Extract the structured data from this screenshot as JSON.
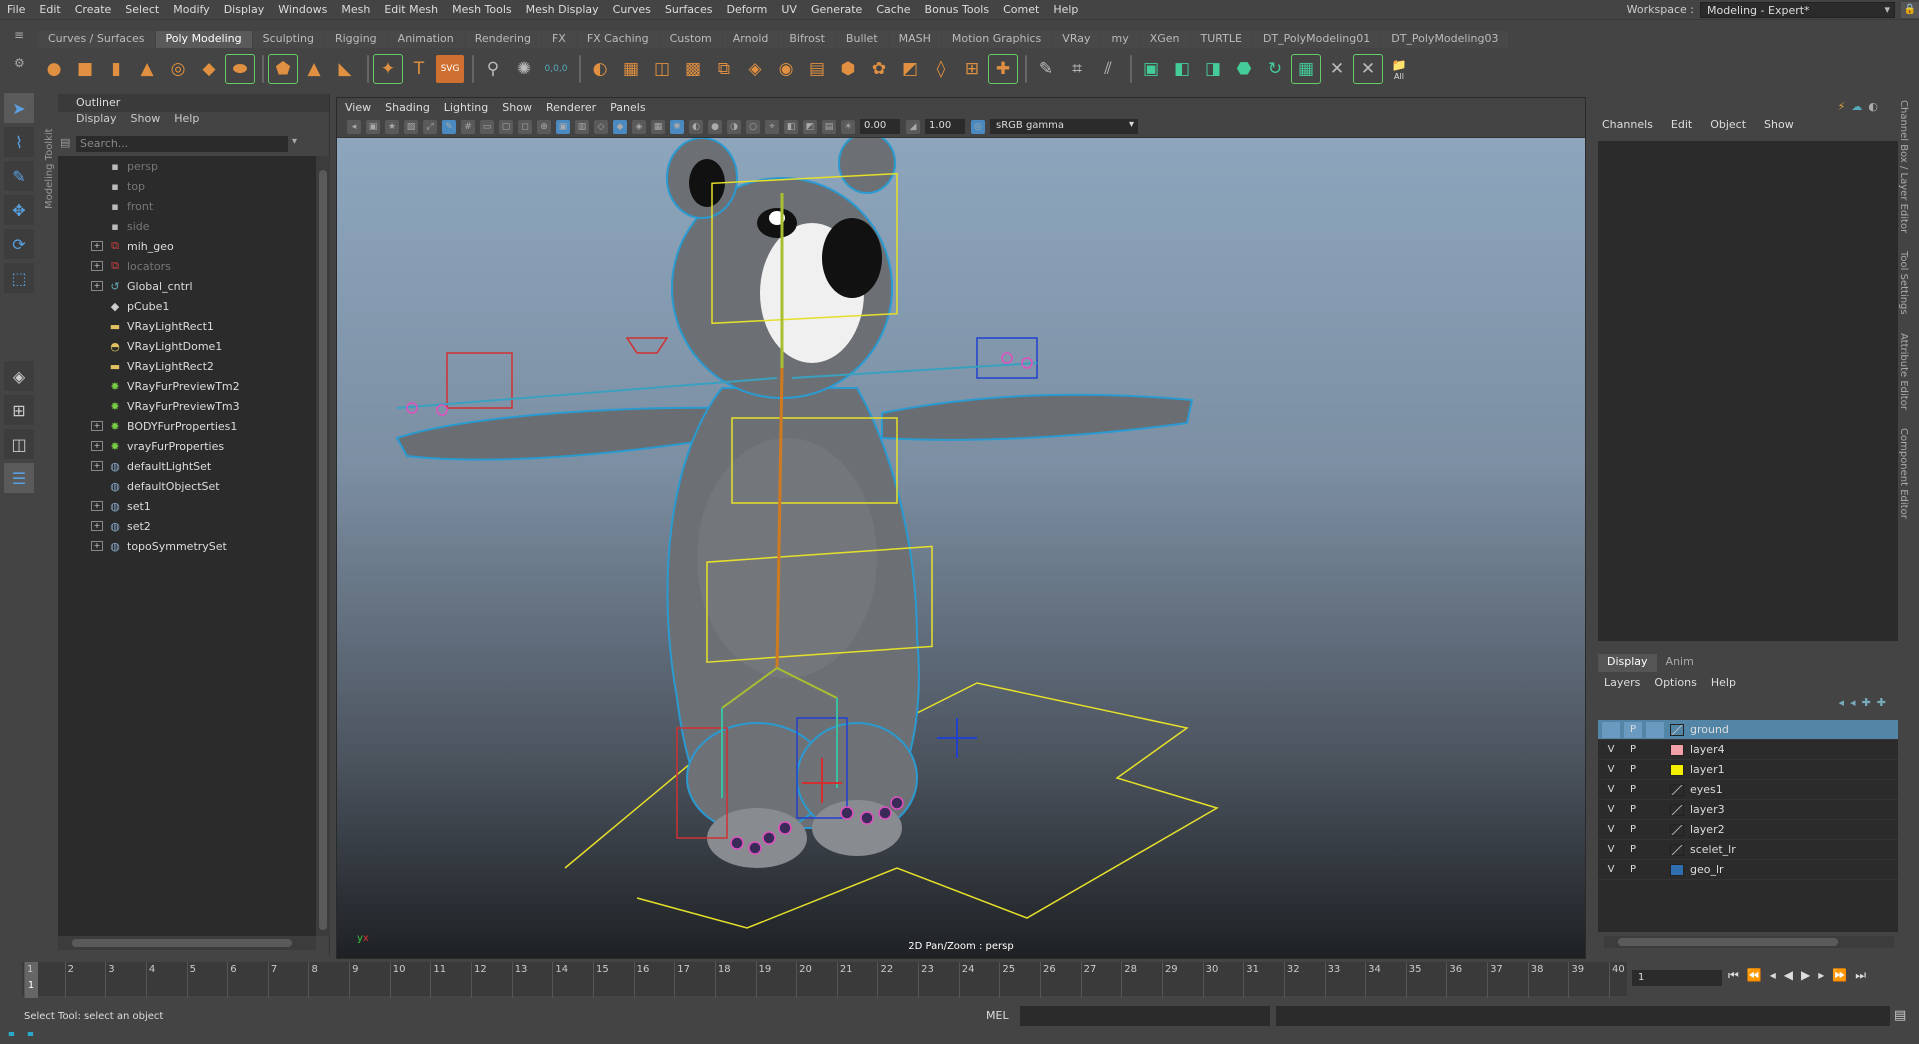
{
  "menubar": {
    "items": [
      "File",
      "Edit",
      "Create",
      "Select",
      "Modify",
      "Display",
      "Windows",
      "Mesh",
      "Edit Mesh",
      "Mesh Tools",
      "Mesh Display",
      "Curves",
      "Surfaces",
      "Deform",
      "UV",
      "Generate",
      "Cache",
      "Bonus Tools",
      "Comet",
      "Help"
    ],
    "workspace_label": "Workspace :",
    "workspace_value": "Modeling - Expert*"
  },
  "shelf": {
    "tabs": [
      "Curves / Surfaces",
      "Poly Modeling",
      "Sculpting",
      "Rigging",
      "Animation",
      "Rendering",
      "FX",
      "FX Caching",
      "Custom",
      "Arnold",
      "Bifrost",
      "Bullet",
      "MASH",
      "Motion Graphics",
      "VRay",
      "my",
      "XGen",
      "TURTLE",
      "DT_PolyModeling01",
      "DT_PolyModeling03"
    ],
    "active_tab": "Poly Modeling",
    "coord_label": "0,0,0",
    "all_label": "All"
  },
  "toolkit_label": "Modeling Toolkit",
  "outliner": {
    "title": "Outliner",
    "menus": [
      "Display",
      "Show",
      "Help"
    ],
    "search_placeholder": "Search...",
    "items": [
      {
        "label": "persp",
        "icon": "camera-icon",
        "expandable": false,
        "dim": true
      },
      {
        "label": "top",
        "icon": "camera-icon",
        "expandable": false,
        "dim": true
      },
      {
        "label": "front",
        "icon": "camera-icon",
        "expandable": false,
        "dim": true
      },
      {
        "label": "side",
        "icon": "camera-icon",
        "expandable": false,
        "dim": true
      },
      {
        "label": "mih_geo",
        "icon": "group-icon",
        "expandable": true,
        "dim": false
      },
      {
        "label": "locators",
        "icon": "group-icon",
        "expandable": true,
        "dim": true
      },
      {
        "label": "Global_cntrl",
        "icon": "curve-icon",
        "expandable": true,
        "dim": false
      },
      {
        "label": "pCube1",
        "icon": "mesh-icon",
        "expandable": false,
        "dim": false
      },
      {
        "label": "VRayLightRect1",
        "icon": "rect-light-icon",
        "expandable": false,
        "dim": false
      },
      {
        "label": "VRayLightDome1",
        "icon": "dome-light-icon",
        "expandable": false,
        "dim": false
      },
      {
        "label": "VRayLightRect2",
        "icon": "rect-light-icon",
        "expandable": false,
        "dim": false
      },
      {
        "label": "VRayFurPreviewTm2",
        "icon": "fur-icon",
        "expandable": false,
        "dim": false
      },
      {
        "label": "VRayFurPreviewTm3",
        "icon": "fur-icon",
        "expandable": false,
        "dim": false
      },
      {
        "label": "BODYFurProperties1",
        "icon": "fur-icon",
        "expandable": true,
        "dim": false
      },
      {
        "label": "vrayFurProperties",
        "icon": "fur-icon",
        "expandable": true,
        "dim": false
      },
      {
        "label": "defaultLightSet",
        "icon": "set-icon",
        "expandable": true,
        "dim": false
      },
      {
        "label": "defaultObjectSet",
        "icon": "set-icon",
        "expandable": false,
        "dim": false
      },
      {
        "label": "set1",
        "icon": "set-icon",
        "expandable": true,
        "dim": false
      },
      {
        "label": "set2",
        "icon": "set-icon",
        "expandable": true,
        "dim": false
      },
      {
        "label": "topoSymmetrySet",
        "icon": "set-icon",
        "expandable": true,
        "dim": false
      }
    ]
  },
  "viewport": {
    "menus": [
      "View",
      "Shading",
      "Lighting",
      "Show",
      "Renderer",
      "Panels"
    ],
    "exposure": "0.00",
    "gamma": "1.00",
    "colorspace": "sRGB gamma",
    "footer": "2D Pan/Zoom : persp"
  },
  "channelbox": {
    "menus": [
      "Channels",
      "Edit",
      "Object",
      "Show"
    ],
    "side_tabs": [
      "Channel Box / Layer Editor",
      "Tool Settings",
      "Attribute Editor",
      "Component Editor"
    ]
  },
  "layers": {
    "tabs": [
      "Display",
      "Anim"
    ],
    "menus": [
      "Layers",
      "Options",
      "Help"
    ],
    "rows": [
      {
        "name": "ground",
        "v": "",
        "p": "P",
        "color": "",
        "selected": true,
        "ref": true
      },
      {
        "name": "layer4",
        "v": "V",
        "p": "P",
        "color": "#f2a0a8",
        "selected": false,
        "ref": false
      },
      {
        "name": "layer1",
        "v": "V",
        "p": "P",
        "color": "#f5f000",
        "selected": false,
        "ref": false
      },
      {
        "name": "eyes1",
        "v": "V",
        "p": "P",
        "color": "",
        "selected": false,
        "ref": false
      },
      {
        "name": "layer3",
        "v": "V",
        "p": "P",
        "color": "",
        "selected": false,
        "ref": false
      },
      {
        "name": "layer2",
        "v": "V",
        "p": "P",
        "color": "",
        "selected": false,
        "ref": false
      },
      {
        "name": "scelet_lr",
        "v": "V",
        "p": "P",
        "color": "",
        "selected": false,
        "ref": false
      },
      {
        "name": "geo_lr",
        "v": "V",
        "p": "P",
        "color": "#2f6fb0",
        "selected": false,
        "ref": false
      }
    ]
  },
  "timeline": {
    "start": 1,
    "end": 40,
    "current": "1",
    "frame_field": "1"
  },
  "status": {
    "help_text": "Select Tool: select an object",
    "mel_label": "MEL"
  }
}
